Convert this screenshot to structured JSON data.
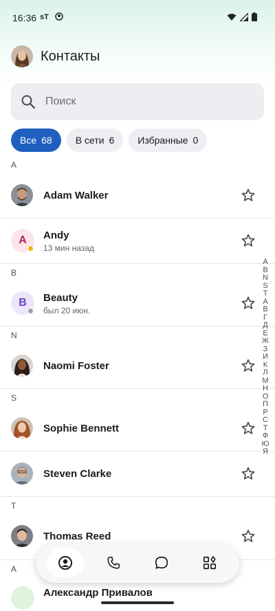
{
  "status_bar": {
    "time": "16:36",
    "carrier": "sT"
  },
  "header": {
    "title": "Контакты"
  },
  "search": {
    "placeholder": "Поиск"
  },
  "filters": [
    {
      "label": "Все",
      "count": "68",
      "active": true
    },
    {
      "label": "В сети",
      "count": "6",
      "active": false
    },
    {
      "label": "Избранные",
      "count": "0",
      "active": false
    }
  ],
  "sections": {
    "a": "A",
    "b": "B",
    "n": "N",
    "s": "S",
    "t": "T",
    "a_cyr": "A"
  },
  "contacts": [
    {
      "name": "Adam Walker",
      "subtitle": ""
    },
    {
      "name": "Andy",
      "subtitle": "13 мин назад",
      "initial": "A"
    },
    {
      "name": "Beauty",
      "subtitle": "был 20 июн.",
      "initial": "B"
    },
    {
      "name": "Naomi Foster",
      "subtitle": ""
    },
    {
      "name": "Sophie Bennett",
      "subtitle": ""
    },
    {
      "name": "Steven Clarke",
      "subtitle": ""
    },
    {
      "name": "Thomas Reed",
      "subtitle": ""
    },
    {
      "name": "Александр Привалов",
      "subtitle": ""
    }
  ],
  "alpha_index": [
    "A",
    "B",
    "N",
    "S",
    "T",
    "А",
    "В",
    "Г",
    "Д",
    "Е",
    "Ж",
    "З",
    "И",
    "К",
    "Л",
    "М",
    "Н",
    "О",
    "П",
    "Р",
    "С",
    "Т",
    "Ф",
    "Ю",
    "Я"
  ],
  "bottom_nav": [
    {
      "icon": "contacts-icon",
      "active": true
    },
    {
      "icon": "phone-icon",
      "active": false
    },
    {
      "icon": "chat-icon",
      "active": false
    },
    {
      "icon": "apps-icon",
      "active": false
    }
  ],
  "colors": {
    "accent": "#1f5fbf",
    "andy_avatar_bg": "#fde4ec",
    "andy_initial": "#b0245f",
    "beauty_avatar_bg": "#ece6fb",
    "beauty_initial": "#6a3cc9",
    "status_away": "#f5b400",
    "status_offline": "#9aa0a6"
  }
}
